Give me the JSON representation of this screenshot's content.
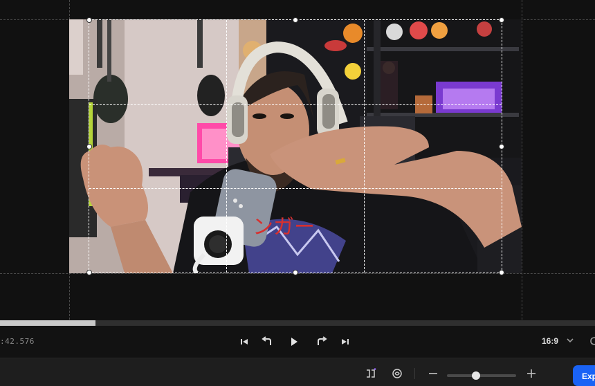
{
  "playback": {
    "timecode": ":42.576",
    "progress_fraction": 0.161,
    "aspect_ratio": "16:9"
  },
  "toolbar": {
    "export_label": "Exp",
    "zoom_level_fraction": 0.42
  },
  "overlay": {
    "shirt_text": "ンガー"
  },
  "icons": {
    "skip_start": "skip-to-start-icon",
    "rewind": "rewind-icon",
    "play": "play-icon",
    "forward": "forward-icon",
    "skip_end": "skip-to-end-icon",
    "aspect_dropdown": "chevron-down-icon",
    "split": "split-icon",
    "ai_tool": "sparkle-edit-icon",
    "zoom_out": "minus-icon",
    "zoom_in": "plus-icon"
  },
  "colors": {
    "accent": "#1a63f5",
    "background": "#121212",
    "crop_guide": "#ffffff"
  }
}
